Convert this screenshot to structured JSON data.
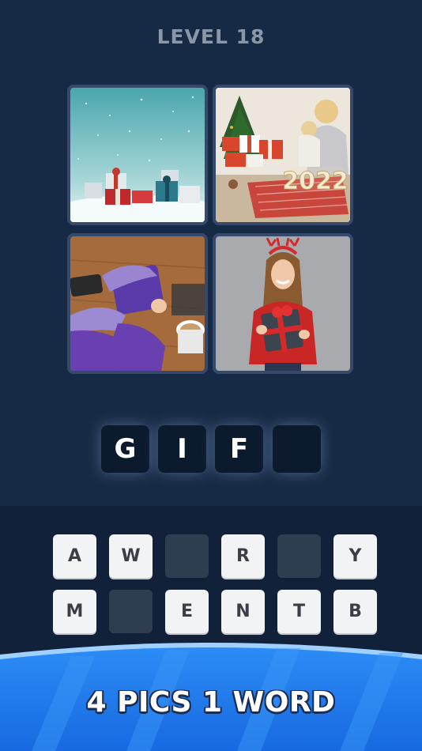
{
  "header": {
    "level_label": "LEVEL 18"
  },
  "pictures": [
    {
      "name": "snowy-gifts-picture"
    },
    {
      "name": "christmas-family-2022-picture",
      "caption": "2022"
    },
    {
      "name": "wrapping-purple-gift-picture"
    },
    {
      "name": "woman-with-gift-picture"
    }
  ],
  "answer": {
    "letters": [
      "G",
      "I",
      "F",
      ""
    ]
  },
  "keyboard": {
    "row1": [
      "A",
      "W",
      "",
      "R",
      "",
      "Y"
    ],
    "row2": [
      "M",
      "",
      "E",
      "N",
      "T",
      "B"
    ]
  },
  "banner": {
    "title": "4 PICS 1 WORD"
  },
  "colors": {
    "background": "#172a45",
    "keyboard_bg": "#11213a",
    "key": "#f2f3f5",
    "used_key": "#2f3d50",
    "banner_blue": "#1e7df0"
  }
}
